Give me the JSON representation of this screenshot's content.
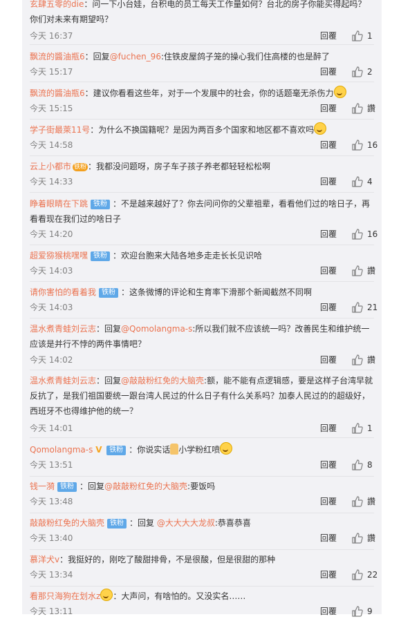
{
  "reply_label": "回覆",
  "comments": [
    {
      "user": "玄肆五零的die",
      "body": "：问一下小台娃，台积电的员工每天工作量如何？台北的房子你能买得起吗？你们对未来有期望吗？",
      "time": "今天 16:37",
      "likes": "1"
    },
    {
      "user": "飘流的醬油瓶6",
      "prefix": "：回复",
      "mention": "@fuchen_96",
      "body": ":住铁皮屋鸽子笼的操心我们住高楼的也是醉了",
      "time": "今天 15:17",
      "likes": "2"
    },
    {
      "user": "飘流的醬油瓶6",
      "body": "：建议你看看这些年，对于一个发展中的社会，你的话题毫无杀伤力",
      "emoji": "grin-emoji",
      "time": "今天 15:15",
      "likes": "讚"
    },
    {
      "user": "学子街最萊11号",
      "body": "：为什么不换国籍呢？是因为两百多个国家和地区都不喜欢吗",
      "emoji": "grin-emoji",
      "time": "今天 14:58",
      "likes": "16"
    },
    {
      "user": "云上小都市",
      "medal": "铁粉",
      "body": "：我都没问题呀，房子车子孩子养老都轻轻松松啊",
      "time": "今天 14:33",
      "likes": "4"
    },
    {
      "user": "睁着眼睛在下跳",
      "badge": "铁粉",
      "body": "：不是越来越好了？你去问问你的父辈祖辈，看看他们过的啥日子，再看看现在我们过的啥日子",
      "time": "今天 14:20",
      "likes": "16"
    },
    {
      "user": "超爱猕猴桃嘿嘿",
      "badge": "铁粉",
      "body": "：欢迎台胞来大陆各地多走走长长见识哈",
      "time": "今天 14:03",
      "likes": "讚"
    },
    {
      "user": "请你害怕的看着我",
      "badge": "铁粉",
      "body": "：这条微博的评论和生育率下滑那个新闻截然不同啊",
      "time": "今天 14:03",
      "likes": "21"
    },
    {
      "user": "温水煮青蛙刘云志",
      "prefix": "：回复",
      "mention": "@Qomolangma-s",
      "body": ":所以我们就不应该统一吗？改善民生和维护统一应该是并行不悖的两件事情吧？",
      "time": "今天 14:02",
      "likes": "讚"
    },
    {
      "user": "温水煮青蛙刘云志",
      "prefix": "：回复",
      "mention": "@敲敲粉红免的大脑壳",
      "body": ":额，能不能有点逻辑感，要是这样子台湾早就反抗了，是我们祖国要统一跟台湾人民过的什么日子有什么关系吗？加泰人民过的的超级好，西班牙不也得维护他的统一？",
      "time": "今天 14:01",
      "likes": "1"
    },
    {
      "user": "Qomolangma-s",
      "verified": "V",
      "badge": "铁粉",
      "body": "：你说实话",
      "body2": "小学粉红喷",
      "emoji": "grin-emoji",
      "time": "今天 13:51",
      "likes": "8"
    },
    {
      "user": "钱一漪",
      "badge": "铁粉",
      "prefix": "：回复",
      "mention": "@敲敲粉红免的大脑壳",
      "body": ":要饭吗",
      "time": "今天 13:48",
      "likes": "讚"
    },
    {
      "user": "敲敲粉红免的大脑壳",
      "badge": "铁粉",
      "prefix": "：回复 ",
      "mention": "@大大大大龙叔",
      "body": ":恭喜恭喜",
      "time": "今天 13:40",
      "likes": "讚"
    },
    {
      "user": "慕洋犬v",
      "body": "：我挺好的，刚吃了酸甜排骨，不是很酸，但是很甜的那种",
      "time": "今天 13:34",
      "likes": "22"
    },
    {
      "user": "看那只海狗在划水z",
      "medal": "",
      "body": "：大声问，有啥怕的。又没实名……",
      "time": "今天 13:11",
      "likes": "9"
    }
  ]
}
